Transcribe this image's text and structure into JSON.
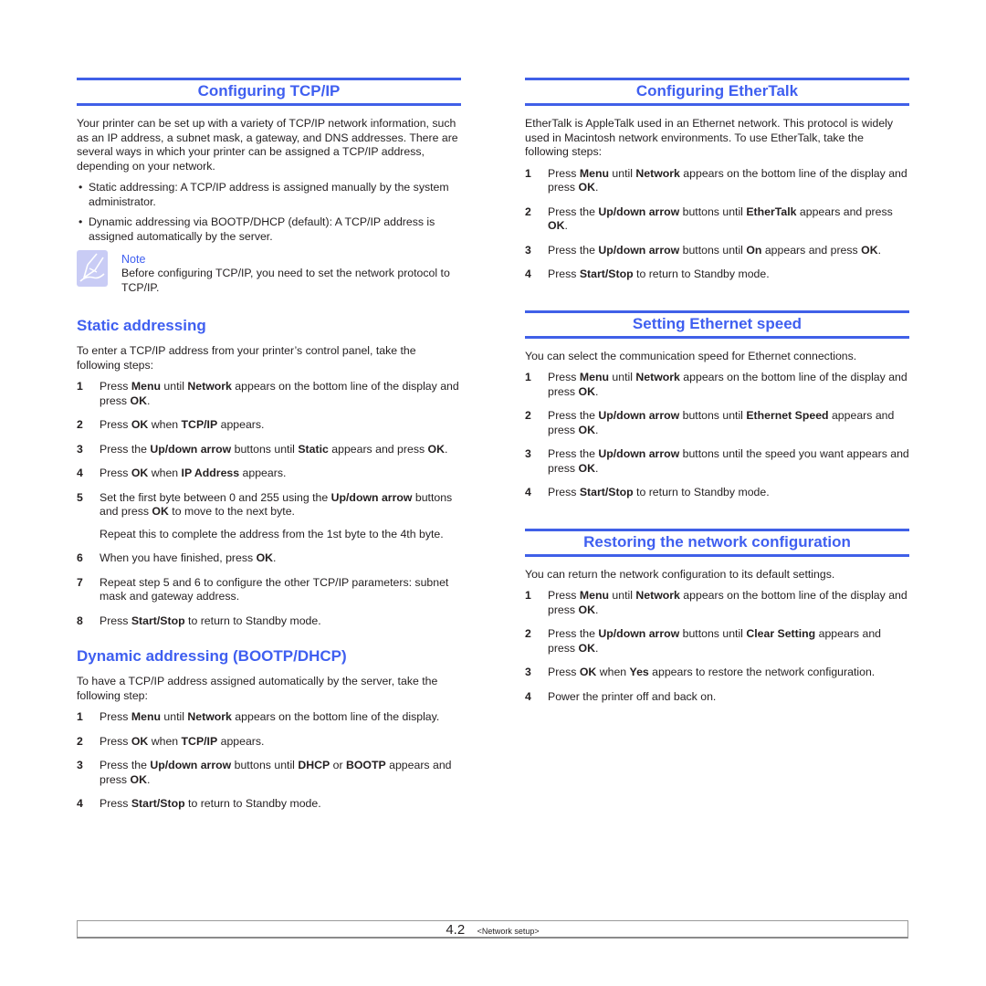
{
  "left": {
    "tcpip": {
      "title": "Configuring TCP/IP",
      "intro": "Your printer can be set up with a variety of TCP/IP network information, such as an IP address, a subnet mask, a gateway, and DNS addresses. There are several ways in which your printer can be assigned a TCP/IP address, depending on your network.",
      "bullets": [
        "Static addressing: A TCP/IP address is assigned manually by the system administrator.",
        "Dynamic addressing via BOOTP/DHCP (default): A TCP/IP address is assigned automatically by the server."
      ],
      "bullet_glyph": "•",
      "note": {
        "icon": "note-pencil-icon",
        "label": "Note",
        "text": "Before configuring TCP/IP, you need to set the network protocol to TCP/IP."
      }
    },
    "static": {
      "title": "Static addressing",
      "intro": "To enter a TCP/IP address from your printer’s control panel, take the following steps:",
      "steps": [
        {
          "num": "1",
          "parts": [
            [
              "Press ",
              false
            ],
            [
              "Menu",
              true
            ],
            [
              " until ",
              false
            ],
            [
              "Network",
              true
            ],
            [
              " appears on the bottom line of the display and press ",
              false
            ],
            [
              "OK",
              true
            ],
            [
              ".",
              false
            ]
          ]
        },
        {
          "num": "2",
          "parts": [
            [
              "Press ",
              false
            ],
            [
              "OK",
              true
            ],
            [
              " when ",
              false
            ],
            [
              "TCP/IP",
              true
            ],
            [
              " appears.",
              false
            ]
          ]
        },
        {
          "num": "3",
          "parts": [
            [
              "Press the ",
              false
            ],
            [
              "Up/down arrow",
              true
            ],
            [
              " buttons until ",
              false
            ],
            [
              "Static",
              true
            ],
            [
              " appears and press ",
              false
            ],
            [
              "OK",
              true
            ],
            [
              ".",
              false
            ]
          ]
        },
        {
          "num": "4",
          "parts": [
            [
              "Press ",
              false
            ],
            [
              "OK",
              true
            ],
            [
              " when ",
              false
            ],
            [
              "IP Address",
              true
            ],
            [
              " appears.",
              false
            ]
          ]
        },
        {
          "num": "5",
          "parts": [
            [
              "Set the first byte between 0 and 255 using the ",
              false
            ],
            [
              "Up/down arrow",
              true
            ],
            [
              " buttons and press ",
              false
            ],
            [
              "OK",
              true
            ],
            [
              " to move to the next byte.",
              false
            ]
          ],
          "extra": "Repeat this to complete the address from the 1st byte to the 4th byte."
        },
        {
          "num": "6",
          "parts": [
            [
              "When you have finished, press ",
              false
            ],
            [
              "OK",
              true
            ],
            [
              ".",
              false
            ]
          ]
        },
        {
          "num": "7",
          "parts": [
            [
              "Repeat step 5 and 6 to configure the other TCP/IP parameters: subnet mask and gateway address.",
              false
            ]
          ]
        },
        {
          "num": "8",
          "parts": [
            [
              "Press ",
              false
            ],
            [
              "Start/Stop",
              true
            ],
            [
              " to return to Standby mode.",
              false
            ]
          ]
        }
      ]
    },
    "dynamic": {
      "title": "Dynamic addressing (BOOTP/DHCP)",
      "intro": "To have a TCP/IP address assigned automatically by the server, take the following step:",
      "steps": [
        {
          "num": "1",
          "parts": [
            [
              "Press ",
              false
            ],
            [
              "Menu",
              true
            ],
            [
              " until ",
              false
            ],
            [
              "Network",
              true
            ],
            [
              " appears on the bottom line of the display.",
              false
            ]
          ]
        },
        {
          "num": "2",
          "parts": [
            [
              "Press ",
              false
            ],
            [
              "OK",
              true
            ],
            [
              " when ",
              false
            ],
            [
              "TCP/IP",
              true
            ],
            [
              " appears.",
              false
            ]
          ]
        },
        {
          "num": "3",
          "parts": [
            [
              "Press the ",
              false
            ],
            [
              "Up/down arrow",
              true
            ],
            [
              " buttons until ",
              false
            ],
            [
              "DHCP",
              true
            ],
            [
              " or ",
              false
            ],
            [
              "BOOTP",
              true
            ],
            [
              " appears and press ",
              false
            ],
            [
              "OK",
              true
            ],
            [
              ".",
              false
            ]
          ]
        },
        {
          "num": "4",
          "parts": [
            [
              "Press ",
              false
            ],
            [
              "Start/Stop",
              true
            ],
            [
              " to return to Standby mode.",
              false
            ]
          ]
        }
      ]
    }
  },
  "right": {
    "ethertalk": {
      "title": "Configuring EtherTalk",
      "intro": "EtherTalk is AppleTalk used in an Ethernet network. This protocol is widely used in Macintosh network environments. To use EtherTalk, take the following steps:",
      "steps": [
        {
          "num": "1",
          "parts": [
            [
              "Press ",
              false
            ],
            [
              "Menu",
              true
            ],
            [
              " until ",
              false
            ],
            [
              "Network",
              true
            ],
            [
              " appears on the bottom line of the display and press ",
              false
            ],
            [
              "OK",
              true
            ],
            [
              ".",
              false
            ]
          ]
        },
        {
          "num": "2",
          "parts": [
            [
              "Press the ",
              false
            ],
            [
              "Up/down arrow",
              true
            ],
            [
              " buttons until ",
              false
            ],
            [
              "EtherTalk",
              true
            ],
            [
              " appears and press ",
              false
            ],
            [
              "OK",
              true
            ],
            [
              ".",
              false
            ]
          ]
        },
        {
          "num": "3",
          "parts": [
            [
              "Press the ",
              false
            ],
            [
              "Up/down arrow",
              true
            ],
            [
              " buttons until ",
              false
            ],
            [
              "On",
              true
            ],
            [
              " appears and press ",
              false
            ],
            [
              "OK",
              true
            ],
            [
              ".",
              false
            ]
          ]
        },
        {
          "num": "4",
          "parts": [
            [
              "Press ",
              false
            ],
            [
              "Start/Stop",
              true
            ],
            [
              " to return to Standby mode.",
              false
            ]
          ]
        }
      ]
    },
    "speed": {
      "title": "Setting Ethernet speed",
      "intro": "You can select the communication speed for Ethernet connections.",
      "steps": [
        {
          "num": "1",
          "parts": [
            [
              "Press ",
              false
            ],
            [
              "Menu",
              true
            ],
            [
              " until ",
              false
            ],
            [
              "Network",
              true
            ],
            [
              " appears on the bottom line of the display and press ",
              false
            ],
            [
              "OK",
              true
            ],
            [
              ".",
              false
            ]
          ]
        },
        {
          "num": "2",
          "parts": [
            [
              "Press the ",
              false
            ],
            [
              "Up/down arrow",
              true
            ],
            [
              " buttons until ",
              false
            ],
            [
              "Ethernet Speed",
              true
            ],
            [
              " appears and press ",
              false
            ],
            [
              "OK",
              true
            ],
            [
              ".",
              false
            ]
          ]
        },
        {
          "num": "3",
          "parts": [
            [
              "Press the ",
              false
            ],
            [
              "Up/down arrow",
              true
            ],
            [
              " buttons until the speed you want appears and press ",
              false
            ],
            [
              "OK",
              true
            ],
            [
              ".",
              false
            ]
          ]
        },
        {
          "num": "4",
          "parts": [
            [
              "Press ",
              false
            ],
            [
              "Start/Stop",
              true
            ],
            [
              " to return to Standby mode.",
              false
            ]
          ]
        }
      ]
    },
    "restore": {
      "title": "Restoring the network configuration",
      "intro": "You can return the network configuration to its default settings.",
      "steps": [
        {
          "num": "1",
          "parts": [
            [
              "Press ",
              false
            ],
            [
              "Menu",
              true
            ],
            [
              " until ",
              false
            ],
            [
              "Network",
              true
            ],
            [
              " appears on the bottom line of the display and press ",
              false
            ],
            [
              "OK",
              true
            ],
            [
              ".",
              false
            ]
          ]
        },
        {
          "num": "2",
          "parts": [
            [
              "Press the ",
              false
            ],
            [
              "Up/down arrow",
              true
            ],
            [
              " buttons until ",
              false
            ],
            [
              "Clear Setting",
              true
            ],
            [
              " appears and press ",
              false
            ],
            [
              "OK",
              true
            ],
            [
              ".",
              false
            ]
          ]
        },
        {
          "num": "3",
          "parts": [
            [
              "Press ",
              false
            ],
            [
              "OK",
              true
            ],
            [
              " when ",
              false
            ],
            [
              "Yes",
              true
            ],
            [
              " appears to restore the network configuration.",
              false
            ]
          ]
        },
        {
          "num": "4",
          "parts": [
            [
              "Power the printer off and back on.",
              false
            ]
          ]
        }
      ]
    }
  },
  "footer": {
    "page_number": "4.2",
    "chapter": "<Network setup>"
  },
  "colors": {
    "accent": "#3f5ff0",
    "text": "#231f20",
    "note_icon": "#c9ccf5"
  }
}
